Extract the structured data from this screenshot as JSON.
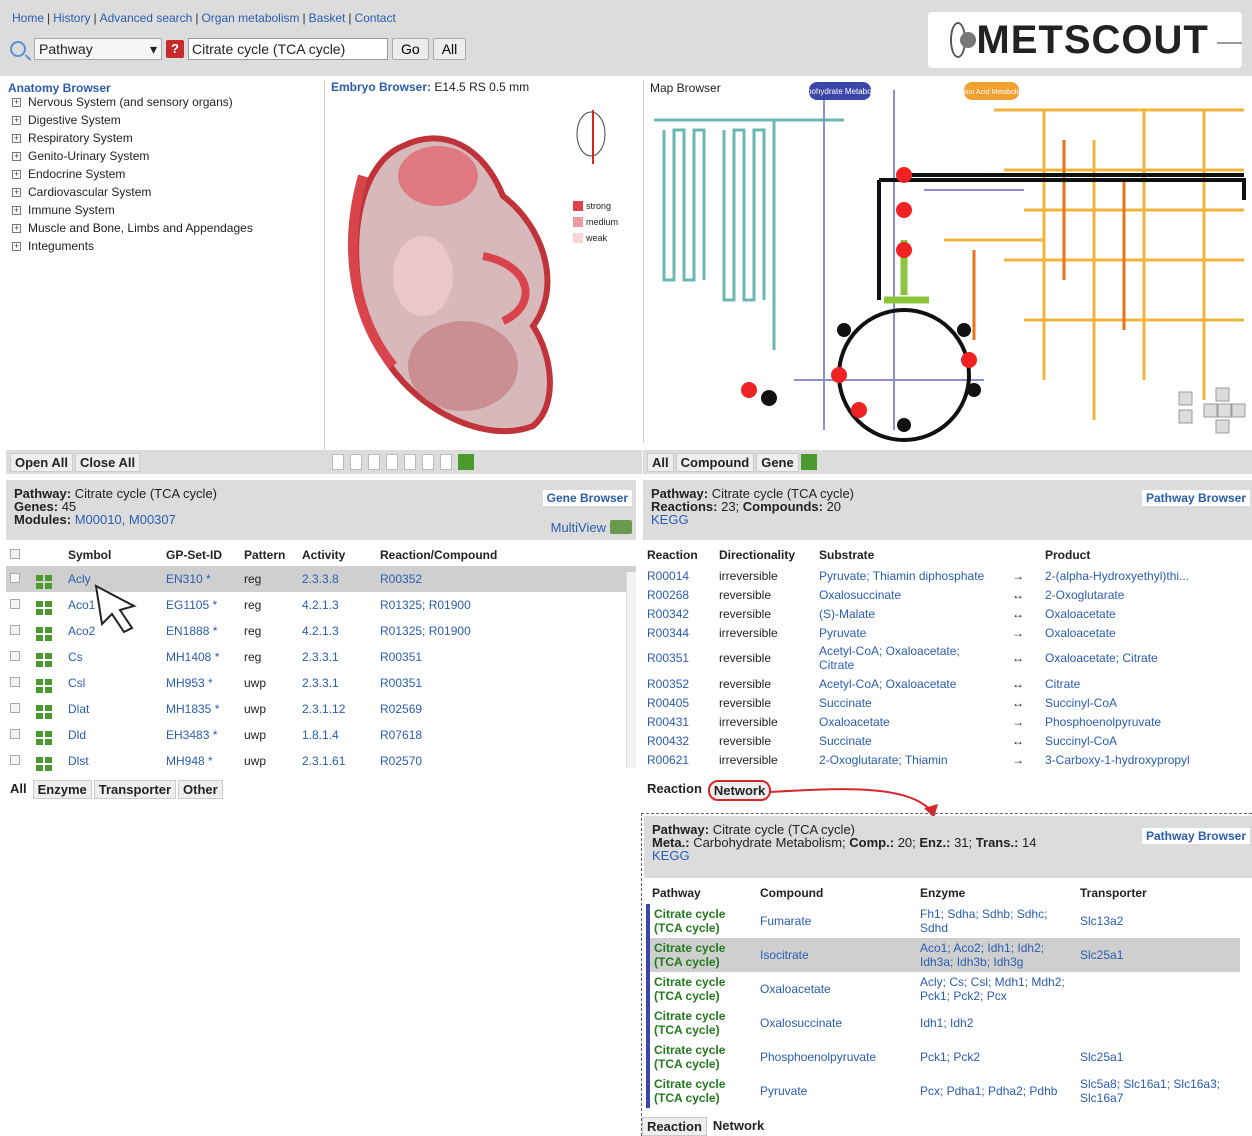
{
  "nav": [
    "Home",
    "History",
    "Advanced search",
    "Organ metabolism",
    "Basket",
    "Contact"
  ],
  "search": {
    "type": "Pathway",
    "value": "Citrate cycle (TCA cycle)",
    "go": "Go",
    "all": "All"
  },
  "logo": {
    "text": "METSCOUT"
  },
  "anatomy": {
    "title": "Anatomy Browser",
    "items": [
      "Nervous System (and sensory organs)",
      "Digestive System",
      "Respiratory System",
      "Genito-Urinary System",
      "Endocrine System",
      "Cardiovascular System",
      "Immune System",
      "Muscle and Bone, Limbs and Appendages",
      "Integuments"
    ],
    "open_all": "Open All",
    "close_all": "Close All"
  },
  "embryo": {
    "title": "Embryo Browser:",
    "stage": "E14.5 RS 0.5 mm",
    "legend": [
      "strong",
      "medium",
      "weak"
    ],
    "legend_colors": [
      "#e0424a",
      "#ef9a9c",
      "#f7d5d6"
    ]
  },
  "map": {
    "title": "Map Browser",
    "labels": [
      "Carbohydrate Metabolism",
      "Amino Acid Metabolism"
    ],
    "tabs": [
      "All",
      "Compound",
      "Gene"
    ]
  },
  "gene": {
    "pathway_label": "Pathway:",
    "pathway": "Citrate cycle (TCA cycle)",
    "genes_label": "Genes:",
    "genes": "45",
    "modules_label": "Modules:",
    "modules": "M00010, M00307",
    "gene_browser": "Gene Browser",
    "multiview": "MultiView",
    "headers": [
      "Symbol",
      "GP-Set-ID",
      "Pattern",
      "Activity",
      "Reaction/Compound"
    ],
    "rows": [
      [
        "Acly",
        "EN310 *",
        "reg",
        "2.3.3.8",
        "R00352"
      ],
      [
        "Aco1",
        "EG1105 *",
        "reg",
        "4.2.1.3",
        "R01325; R01900"
      ],
      [
        "Aco2",
        "EN1888 *",
        "reg",
        "4.2.1.3",
        "R01325; R01900"
      ],
      [
        "Cs",
        "MH1408 *",
        "reg",
        "2.3.3.1",
        "R00351"
      ],
      [
        "Csl",
        "MH953 *",
        "uwp",
        "2.3.3.1",
        "R00351"
      ],
      [
        "Dlat",
        "MH1835 *",
        "uwp",
        "2.3.1.12",
        "R02569"
      ],
      [
        "Dld",
        "EH3483 *",
        "uwp",
        "1.8.1.4",
        "R07618"
      ],
      [
        "Dlst",
        "MH948 *",
        "uwp",
        "2.3.1.61",
        "R02570"
      ]
    ],
    "tabs": [
      "All",
      "Enzyme",
      "Transporter",
      "Other"
    ]
  },
  "pathway": {
    "pathway_label": "Pathway:",
    "pathway": "Citrate cycle (TCA cycle)",
    "reactions_label": "Reactions:",
    "reactions": "23",
    "compounds_label": "Compounds:",
    "compounds": "20",
    "kegg": "KEGG",
    "browser": "Pathway Browser",
    "headers": [
      "Reaction",
      "Directionality",
      "Substrate",
      "",
      "Product"
    ],
    "rows": [
      [
        "R00014",
        "irreversible",
        "Pyruvate; Thiamin diphosphate",
        "→",
        "2-(alpha-Hydroxyethyl)thi..."
      ],
      [
        "R00268",
        "reversible",
        "Oxalosuccinate",
        "↔",
        "2-Oxoglutarate"
      ],
      [
        "R00342",
        "reversible",
        "(S)-Malate",
        "↔",
        "Oxaloacetate"
      ],
      [
        "R00344",
        "irreversible",
        "Pyruvate",
        "→",
        "Oxaloacetate"
      ],
      [
        "R00351",
        "reversible",
        "Acetyl-CoA; Oxaloacetate; Citrate",
        "↔",
        "Oxaloacetate; Citrate"
      ],
      [
        "R00352",
        "reversible",
        "Acetyl-CoA; Oxaloacetate",
        "↔",
        "Citrate"
      ],
      [
        "R00405",
        "reversible",
        "Succinate",
        "↔",
        "Succinyl-CoA"
      ],
      [
        "R00431",
        "irreversible",
        "Oxaloacetate",
        "→",
        "Phosphoenolpyruvate"
      ],
      [
        "R00432",
        "reversible",
        "Succinate",
        "↔",
        "Succinyl-CoA"
      ],
      [
        "R00621",
        "irreversible",
        "2-Oxoglutarate; Thiamin",
        "→",
        "3-Carboxy-1-hydroxypropyl"
      ]
    ],
    "tabs": [
      "Reaction",
      "Network"
    ]
  },
  "network": {
    "pathway_label": "Pathway:",
    "pathway": "Citrate cycle (TCA cycle)",
    "meta_label": "Meta.:",
    "meta": "Carbohydrate Metabolism;",
    "comp_label": "Comp.:",
    "comp": "20;",
    "enz_label": "Enz.:",
    "enz": "31;",
    "trans_label": "Trans.:",
    "trans": "14",
    "kegg": "KEGG",
    "browser": "Pathway Browser",
    "headers": [
      "Pathway",
      "Compound",
      "Enzyme",
      "Transporter"
    ],
    "rows": [
      [
        "Citrate cycle (TCA cycle)",
        "Fumarate",
        "Fh1; Sdha; Sdhb; Sdhc; Sdhd",
        "Slc13a2"
      ],
      [
        "Citrate cycle (TCA cycle)",
        "Isocitrate",
        "Aco1; Aco2; Idh1; Idh2; Idh3a; Idh3b; Idh3g",
        "Slc25a1"
      ],
      [
        "Citrate cycle (TCA cycle)",
        "Oxaloacetate",
        "Acly; Cs; Csl; Mdh1; Mdh2; Pck1; Pck2; Pcx",
        ""
      ],
      [
        "Citrate cycle (TCA cycle)",
        "Oxalosuccinate",
        "Idh1; Idh2",
        ""
      ],
      [
        "Citrate cycle (TCA cycle)",
        "Phosphoenolpyruvate",
        "Pck1; Pck2",
        "Slc25a1"
      ],
      [
        "Citrate cycle (TCA cycle)",
        "Pyruvate",
        "Pcx; Pdha1; Pdha2; Pdhb",
        "Slc5a8; Slc16a1; Slc16a3; Slc16a7"
      ]
    ],
    "tabs": [
      "Reaction",
      "Network"
    ]
  }
}
